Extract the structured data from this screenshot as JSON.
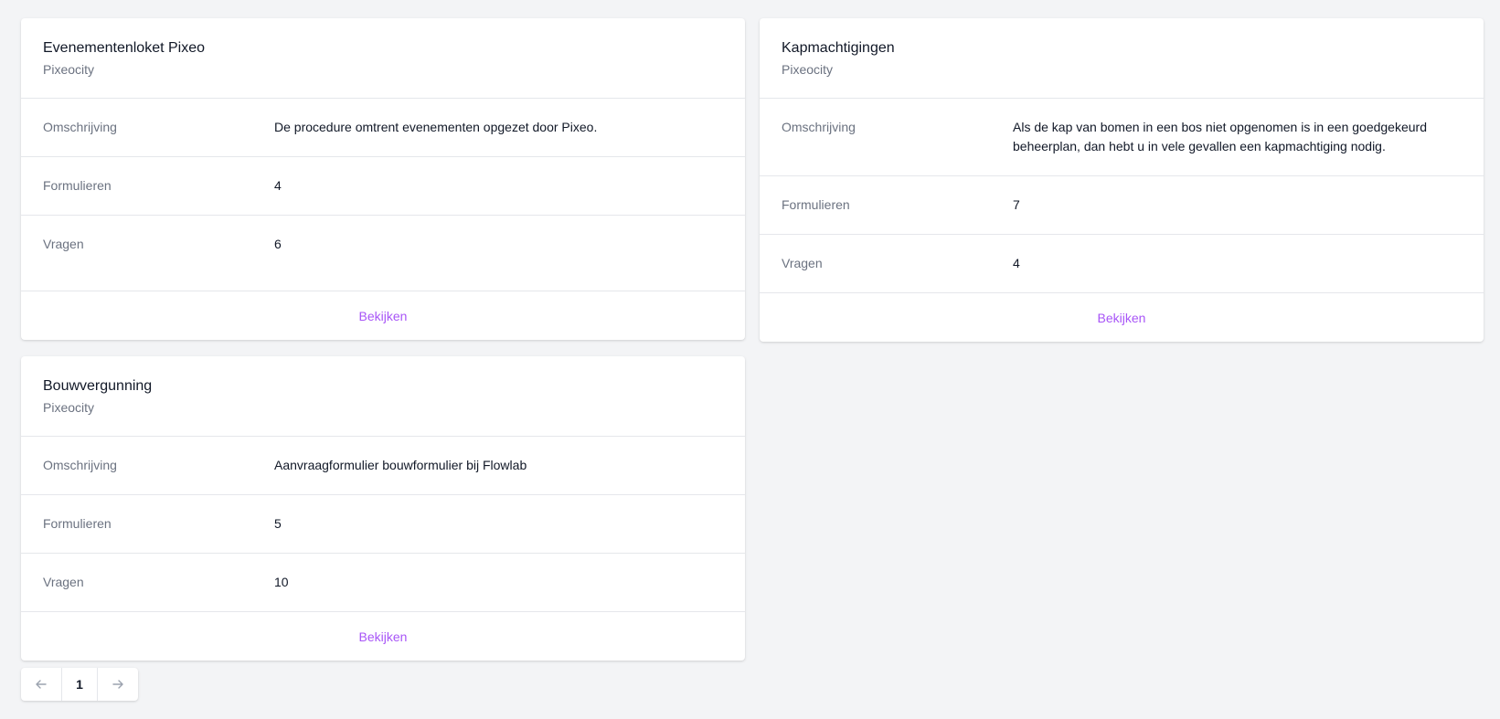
{
  "cards": [
    {
      "title": "Evenementenloket Pixeo",
      "subtitle": "Pixeocity",
      "rows": [
        {
          "label": "Omschrijving",
          "value": "De procedure omtrent evenementen opgezet door Pixeo."
        },
        {
          "label": "Formulieren",
          "value": "4"
        },
        {
          "label": "Vragen",
          "value": "6"
        }
      ],
      "action": "Bekijken"
    },
    {
      "title": "Kapmachtigingen",
      "subtitle": "Pixeocity",
      "rows": [
        {
          "label": "Omschrijving",
          "value": "Als de kap van bomen in een bos niet opgenomen is in een goedgekeurd beheerplan, dan hebt u in vele gevallen een kapmachtiging nodig."
        },
        {
          "label": "Formulieren",
          "value": "7"
        },
        {
          "label": "Vragen",
          "value": "4"
        }
      ],
      "action": "Bekijken"
    },
    {
      "title": "Bouwvergunning",
      "subtitle": "Pixeocity",
      "rows": [
        {
          "label": "Omschrijving",
          "value": "Aanvraagformulier bouwformulier bij Flowlab"
        },
        {
          "label": "Formulieren",
          "value": "5"
        },
        {
          "label": "Vragen",
          "value": "10"
        }
      ],
      "action": "Bekijken"
    }
  ],
  "pagination": {
    "current_page": "1",
    "prev_icon": "arrow-left-icon",
    "next_icon": "arrow-right-icon"
  },
  "colors": {
    "accent": "#a855f7",
    "background": "#f3f4f6",
    "muted_text": "#6b7280",
    "border": "#e5e7eb"
  }
}
